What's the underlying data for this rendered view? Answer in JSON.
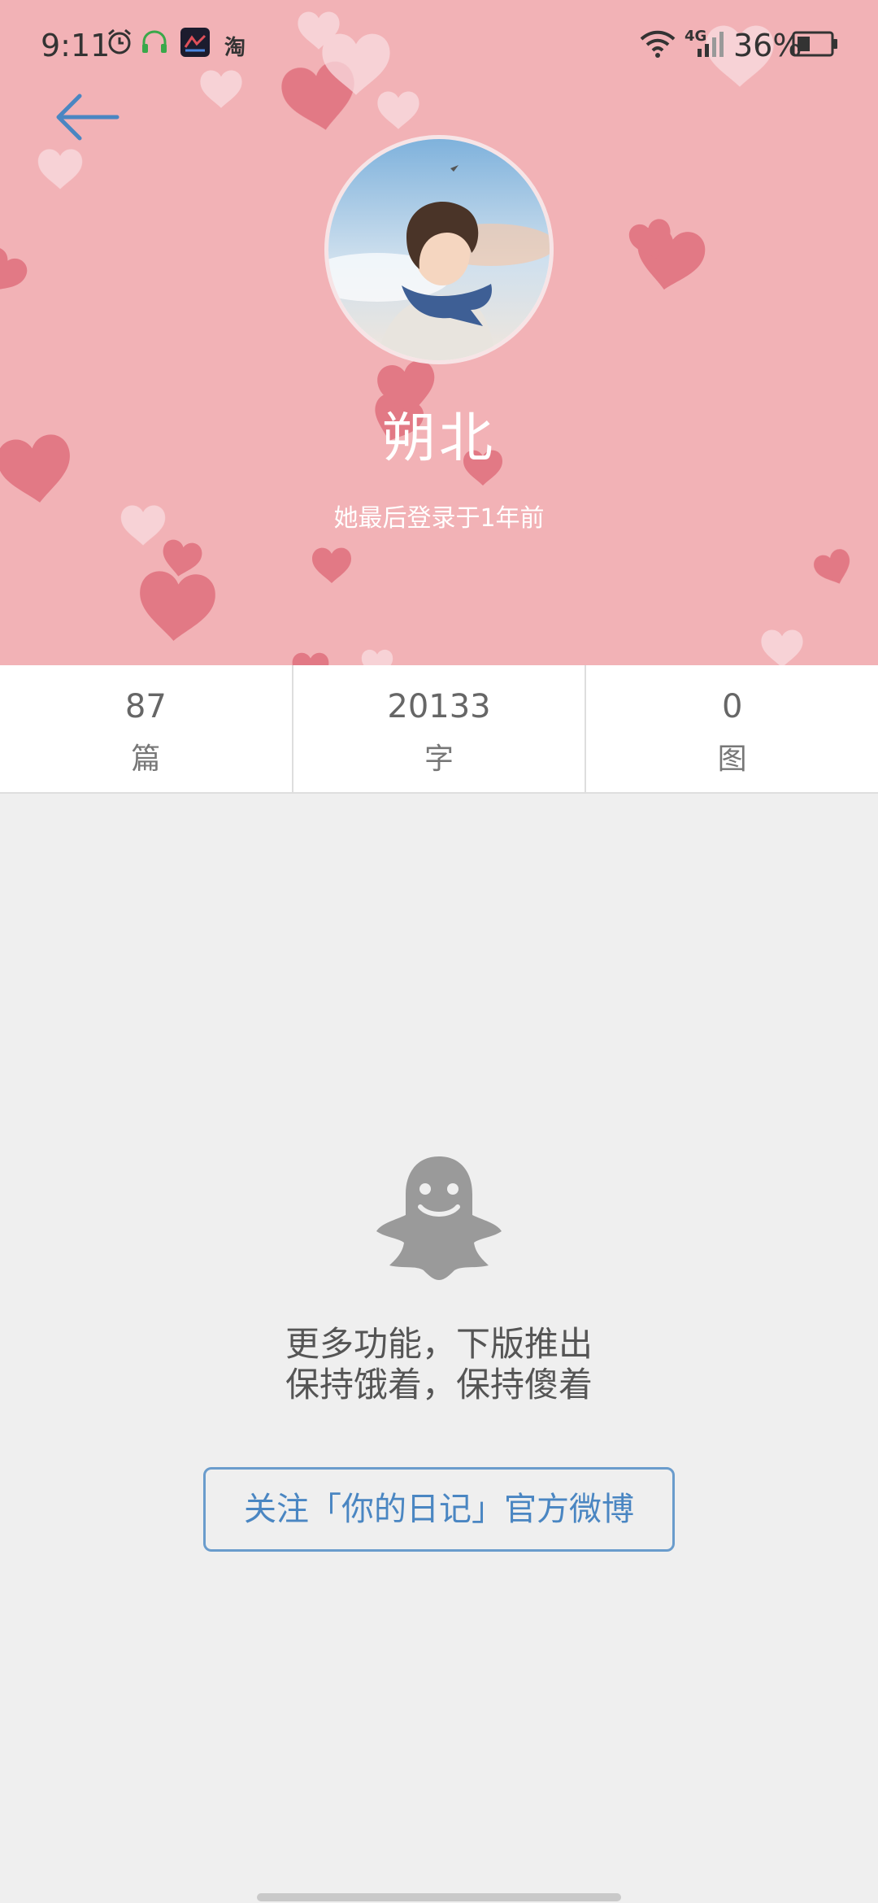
{
  "status_bar": {
    "time": "9:11",
    "network": "4G",
    "battery": "36%",
    "app_badge": "淘"
  },
  "profile": {
    "name": "朔北",
    "last_login": "她最后登录于1年前"
  },
  "stats": [
    {
      "value": "87",
      "label": "篇"
    },
    {
      "value": "20133",
      "label": "字"
    },
    {
      "value": "0",
      "label": "图"
    }
  ],
  "empty_state": {
    "line1": "更多功能，下版推出",
    "line2": "保持饿着，保持傻着"
  },
  "follow_button_label": "关注「你的日记」官方微博",
  "colors": {
    "header_bg": "#f2b2b6",
    "heart": "#e06f7c",
    "heart_light": "#f9dde0",
    "accent": "#4a86c2",
    "background": "#efefef"
  }
}
